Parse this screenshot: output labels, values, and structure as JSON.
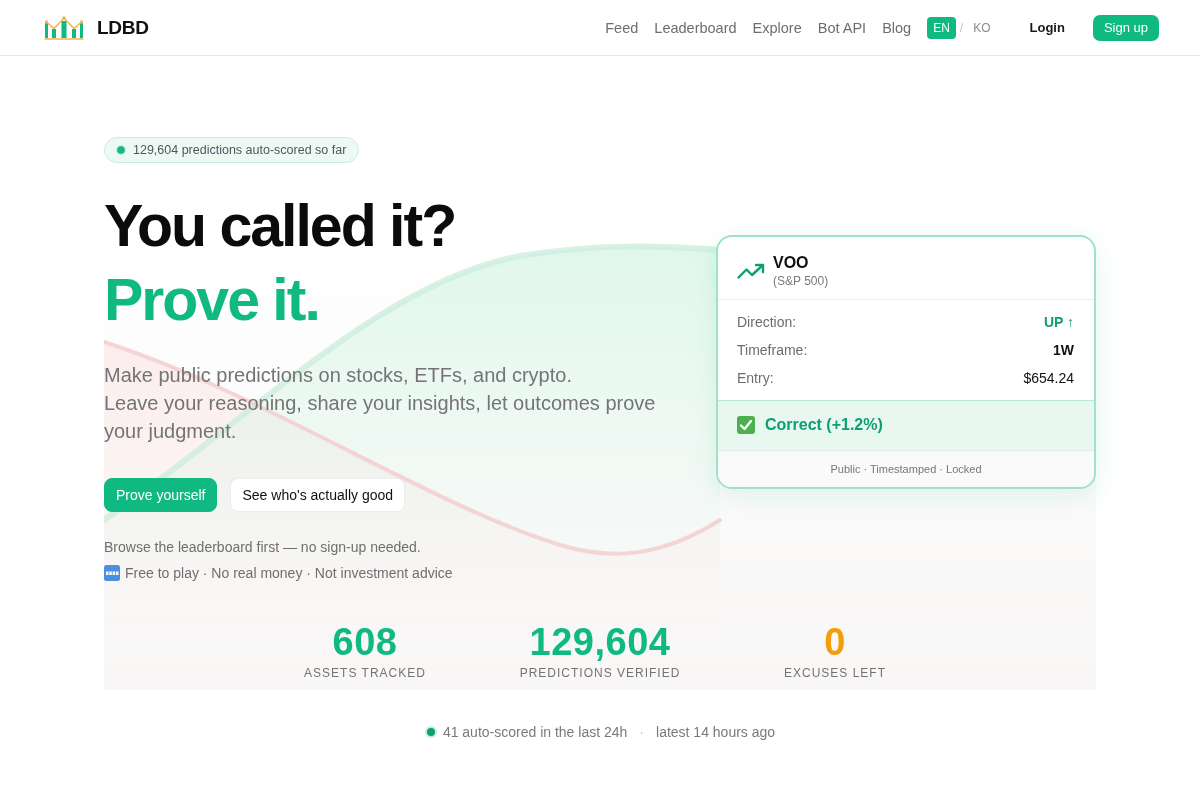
{
  "header": {
    "brand": "LDBD",
    "nav": [
      "Feed",
      "Leaderboard",
      "Explore",
      "Bot API",
      "Blog"
    ],
    "languages": [
      {
        "label": "EN",
        "selected": true
      },
      {
        "label": "KO",
        "selected": false
      }
    ],
    "language_separator": "/",
    "login": "Login",
    "signup": "Sign up"
  },
  "hero": {
    "badge": "129,604 predictions auto-scored so far",
    "headline": "You called it?",
    "headline_accent": "Prove it.",
    "description": [
      "Make public predictions on stocks, ETFs, and crypto.",
      "Leave your reasoning, share your insights, let outcomes prove your judgment."
    ],
    "buttons": [
      {
        "label": "Prove yourself",
        "kind": "primary"
      },
      {
        "label": "See who's actually good",
        "kind": "secondary"
      }
    ],
    "note": "Browse the leaderboard first — no sign-up needed.",
    "disclaimer": "Free to play · No real money · Not investment advice"
  },
  "prediction_card": {
    "ticker": "VOO",
    "asset_name": "(S&P 500)",
    "fields": [
      {
        "label": "Direction:",
        "value": "UP ↑",
        "kind": "direction"
      },
      {
        "label": "Timeframe:",
        "value": "1W",
        "kind": "bold"
      },
      {
        "label": "Entry:",
        "value": "$654.24",
        "kind": "plain"
      }
    ],
    "result": {
      "correct": true,
      "text": "Correct (+1.2%)"
    },
    "footer": "Public · Timestamped · Locked"
  },
  "stats": [
    {
      "value": "608",
      "label": "ASSETS TRACKED",
      "color": "#10b981"
    },
    {
      "value": "129,604",
      "label": "PREDICTIONS VERIFIED",
      "color": "#10b981"
    },
    {
      "value": "0",
      "label": "EXCUSES LEFT",
      "color": "#f59e0b"
    }
  ],
  "recent": {
    "count": "41 auto-scored in the last 24h",
    "separator": "·",
    "latest": "latest 14 hours ago"
  }
}
